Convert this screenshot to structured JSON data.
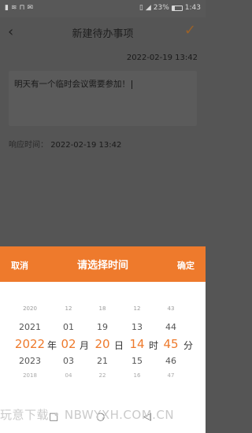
{
  "status_bar": {
    "icons_left": [
      "sim-icon",
      "wifi-icon",
      "nfc-icon",
      "mail-icon"
    ],
    "battery": "23%",
    "time": "1:43"
  },
  "header": {
    "title": "新建待办事项",
    "back_icon": "chevron-left-icon",
    "confirm_icon": "check-icon"
  },
  "todo": {
    "created_time": "2022-02-19 13:42",
    "content": "明天有一个临时会议需要参加！",
    "remind_label": "响应时间：",
    "remind_value": "2022-02-19 13:42"
  },
  "picker": {
    "cancel": "取消",
    "title": "请选择时间",
    "ok": "确定",
    "columns": [
      {
        "values": [
          "2020",
          "2021",
          "2022",
          "2023",
          "2018"
        ],
        "unit": "年"
      },
      {
        "values": [
          "12",
          "01",
          "02",
          "03",
          "04"
        ],
        "unit": "月"
      },
      {
        "values": [
          "18",
          "19",
          "20",
          "21",
          "22"
        ],
        "unit": "日"
      },
      {
        "values": [
          "12",
          "13",
          "14",
          "15",
          "16"
        ],
        "unit": "时"
      },
      {
        "values": [
          "43",
          "44",
          "45",
          "46",
          "47"
        ],
        "unit": "分"
      }
    ]
  },
  "watermark": "玩意下载 • NBWYXH.COM.CN"
}
